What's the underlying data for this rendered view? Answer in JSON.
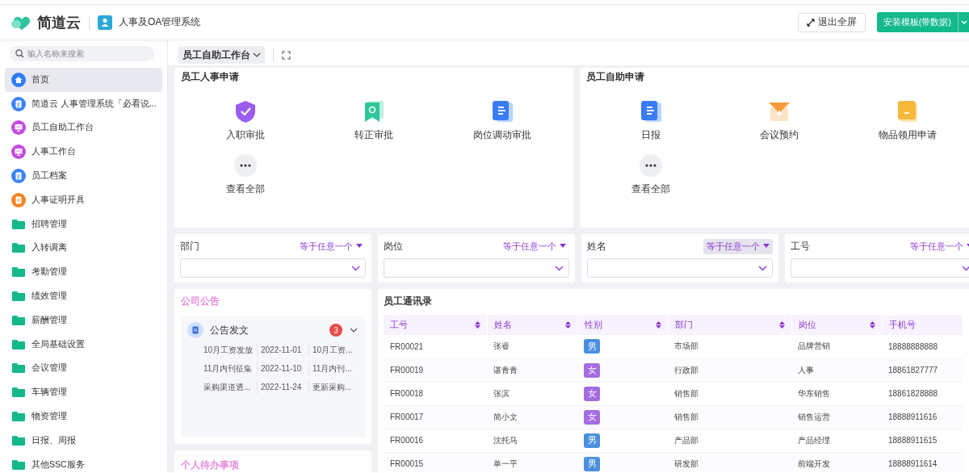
{
  "header": {
    "brand": "简道云",
    "app_title": "人事及OA管理系统",
    "exit_fullscreen": "退出全屏",
    "install_button": "安装模板(带数据)"
  },
  "sidebar": {
    "search": {
      "placeholder": "输入名称来搜索"
    },
    "items": [
      {
        "label": "首页",
        "kind": "home",
        "selected": true
      },
      {
        "label": "简道云 人事管理系统「必看说...",
        "kind": "doc",
        "selected": false
      },
      {
        "label": "员工自助工作台",
        "kind": "dashboard",
        "selected": false
      },
      {
        "label": "人事工作台",
        "kind": "dashboard",
        "selected": false
      },
      {
        "label": "员工档案",
        "kind": "doc",
        "selected": false
      },
      {
        "label": "人事证明开具",
        "kind": "cert",
        "selected": false
      },
      {
        "label": "招聘管理",
        "kind": "folder",
        "selected": false
      },
      {
        "label": "入转调离",
        "kind": "folder",
        "selected": false
      },
      {
        "label": "考勤管理",
        "kind": "folder",
        "selected": false
      },
      {
        "label": "绩效管理",
        "kind": "folder",
        "selected": false
      },
      {
        "label": "薪酬管理",
        "kind": "folder",
        "selected": false
      },
      {
        "label": "全局基础设置",
        "kind": "folder",
        "selected": false
      },
      {
        "label": "会议管理",
        "kind": "folder",
        "selected": false
      },
      {
        "label": "车辆管理",
        "kind": "folder",
        "selected": false
      },
      {
        "label": "物资管理",
        "kind": "folder",
        "selected": false
      },
      {
        "label": "日报、周报",
        "kind": "folder",
        "selected": false
      },
      {
        "label": "其他SSC服务",
        "kind": "folder",
        "selected": false
      }
    ]
  },
  "toolbar": {
    "dashboard_tab": "员工自助工作台"
  },
  "shortcut_panels": [
    {
      "title": "员工人事申请",
      "items": [
        {
          "label": "入职审批",
          "kind": "shield"
        },
        {
          "label": "转正审批",
          "kind": "bookmark"
        },
        {
          "label": "岗位调动审批",
          "kind": "doc"
        },
        {
          "label": "查看全部",
          "kind": "more"
        }
      ]
    },
    {
      "title": "员工自助申请",
      "items": [
        {
          "label": "日报",
          "kind": "doc"
        },
        {
          "label": "会议预约",
          "kind": "envelope"
        },
        {
          "label": "物品领用申请",
          "kind": "folder"
        },
        {
          "label": "查看全部",
          "kind": "more"
        }
      ]
    }
  ],
  "filters": [
    {
      "label": "部门",
      "operator": "等于任意一个",
      "hovered": false
    },
    {
      "label": "岗位",
      "operator": "等于任意一个",
      "hovered": false
    },
    {
      "label": "姓名",
      "operator": "等于任意一个",
      "hovered": true
    },
    {
      "label": "工号",
      "operator": "等于任意一个",
      "hovered": false
    }
  ],
  "announcements": {
    "title": "公司公告",
    "group": {
      "name": "公告发文",
      "count": "3",
      "expanded": true,
      "rows": [
        [
          "10月工资发放",
          "2022-11-01",
          "10月工资..."
        ],
        [
          "11月内刊征集",
          "2022-11-10",
          "11月内刊..."
        ],
        [
          "采购渠道透...",
          "2022-11-24",
          "更新采购..."
        ]
      ]
    }
  },
  "todo": {
    "title": "个人待办事项"
  },
  "directory": {
    "title": "员工通讯录",
    "columns": [
      {
        "label": "工号",
        "sortable": true
      },
      {
        "label": "姓名",
        "sortable": true
      },
      {
        "label": "性别",
        "sortable": true
      },
      {
        "label": "部门",
        "sortable": true
      },
      {
        "label": "岗位",
        "sortable": true
      },
      {
        "label": "手机号",
        "sortable": false
      }
    ],
    "rows": [
      {
        "id": "FR00021",
        "name": "张睿",
        "gender": {
          "text": "男",
          "color": "#4a8fe0"
        },
        "dept": "市场部",
        "position": "品牌营销",
        "phone": "18888888888"
      },
      {
        "id": "FR00019",
        "name": "谌青青",
        "gender": {
          "text": "女",
          "color": "#a56be0"
        },
        "dept": "行政部",
        "position": "人事",
        "phone": "18861827777"
      },
      {
        "id": "FR00018",
        "name": "张滨",
        "gender": {
          "text": "女",
          "color": "#a56be0"
        },
        "dept": "销售部",
        "position": "华东销售",
        "phone": "18861828888"
      },
      {
        "id": "FR00017",
        "name": "简小文",
        "gender": {
          "text": "女",
          "color": "#a56be0"
        },
        "dept": "销售部",
        "position": "销售运营",
        "phone": "18888911616"
      },
      {
        "id": "FR00016",
        "name": "沈托马",
        "gender": {
          "text": "男",
          "color": "#4a8fe0"
        },
        "dept": "产品部",
        "position": "产品经理",
        "phone": "18888911615"
      },
      {
        "id": "FR00015",
        "name": "单一平",
        "gender": {
          "text": "男",
          "color": "#4a8fe0"
        },
        "dept": "研发部",
        "position": "前端开发",
        "phone": "18888911614"
      }
    ]
  }
}
